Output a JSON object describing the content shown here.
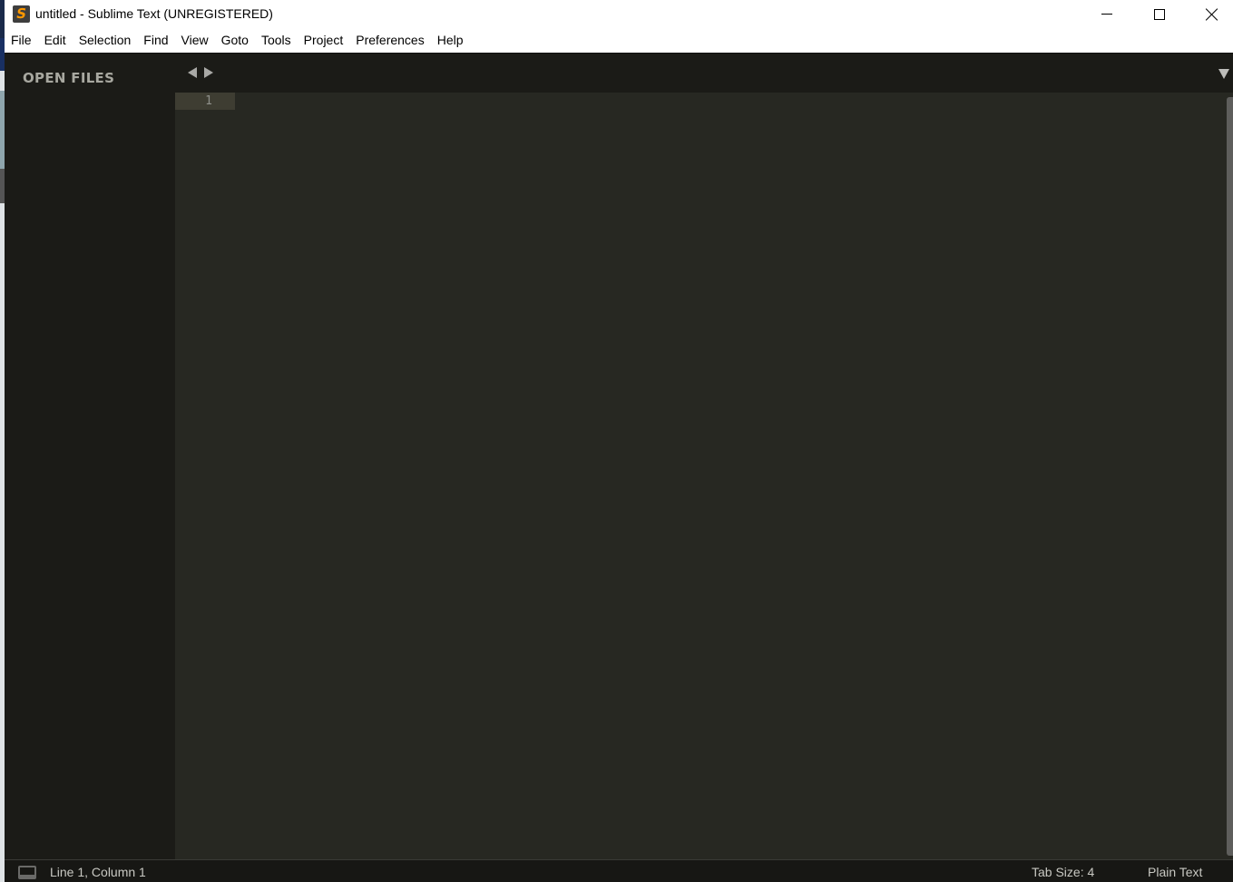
{
  "window": {
    "title": "untitled - Sublime Text (UNREGISTERED)",
    "app_icon": "sublime-text-logo",
    "app_icon_glyph": "S",
    "controls": [
      "minimize",
      "maximize",
      "close"
    ]
  },
  "menubar": {
    "items": [
      "File",
      "Edit",
      "Selection",
      "Find",
      "View",
      "Goto",
      "Tools",
      "Project",
      "Preferences",
      "Help"
    ]
  },
  "sidebar": {
    "title": "OPEN FILES",
    "files": []
  },
  "tabstrip": {
    "nav_left_icon": "triangle-left-icon",
    "nav_right_icon": "triangle-right-icon",
    "menu_icon": "triangle-down-icon"
  },
  "editor": {
    "line_numbers": [
      "1"
    ],
    "content": "",
    "colors": {
      "background": "#272822",
      "gutter_highlight": "#3e3d32",
      "sidebar": "#1b1b17"
    }
  },
  "statusbar": {
    "position": "Line 1, Column 1",
    "tab_size": "Tab Size: 4",
    "syntax": "Plain Text"
  }
}
